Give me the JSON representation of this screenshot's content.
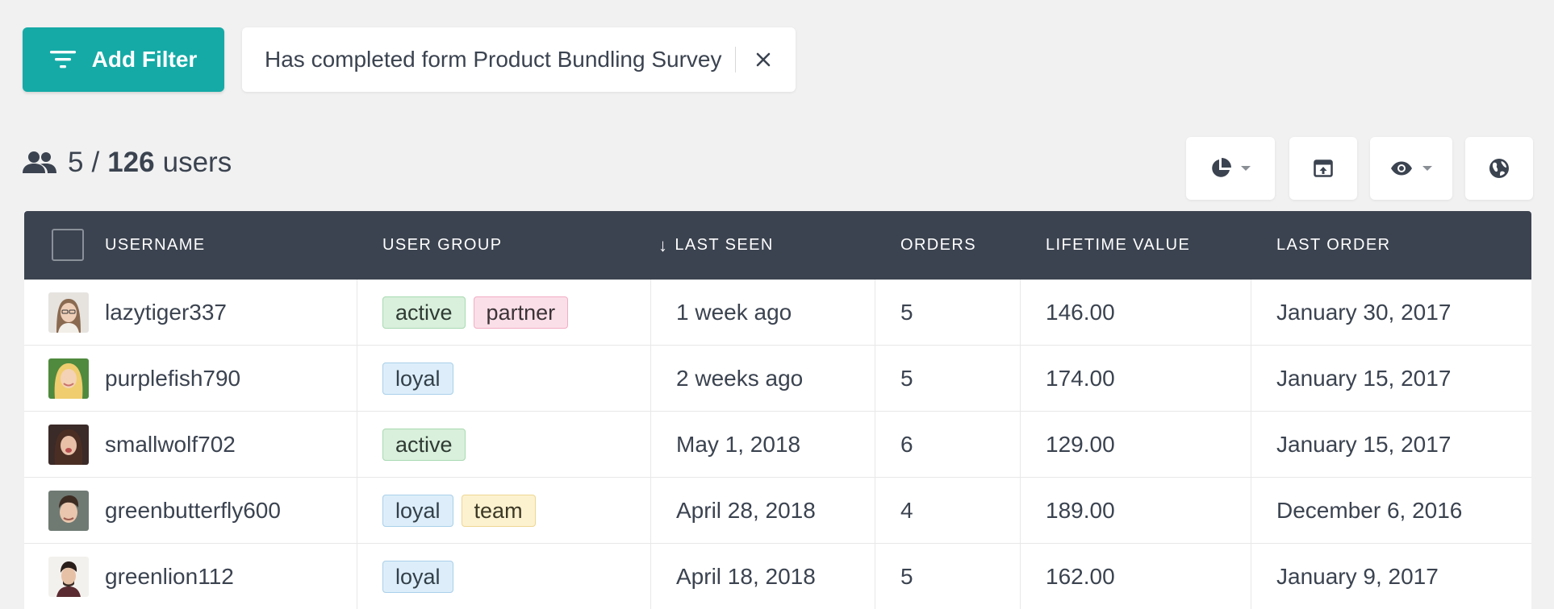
{
  "filter_bar": {
    "add_filter_label": "Add Filter",
    "active_filter": "Has completed form Product Bundling Survey"
  },
  "summary": {
    "shown": "5",
    "separator": "/",
    "total": "126",
    "unit": "users"
  },
  "toolbar": {
    "icons": [
      "pie-chart-icon",
      "export-icon",
      "eye-icon",
      "globe-icon"
    ]
  },
  "table": {
    "columns": {
      "username": "USERNAME",
      "user_group": "USER GROUP",
      "last_seen": "LAST SEEN",
      "orders": "ORDERS",
      "lifetime_value": "LIFETIME VALUE",
      "last_order": "LAST ORDER"
    },
    "sort_indicator": "↓",
    "rows": [
      {
        "username": "lazytiger337",
        "groups": [
          "active",
          "partner"
        ],
        "last_seen": "1 week ago",
        "orders": "5",
        "lifetime_value": "146.00",
        "last_order": "January 30, 2017"
      },
      {
        "username": "purplefish790",
        "groups": [
          "loyal"
        ],
        "last_seen": "2 weeks ago",
        "orders": "5",
        "lifetime_value": "174.00",
        "last_order": "January 15, 2017"
      },
      {
        "username": "smallwolf702",
        "groups": [
          "active"
        ],
        "last_seen": "May 1, 2018",
        "orders": "6",
        "lifetime_value": "129.00",
        "last_order": "January 15, 2017"
      },
      {
        "username": "greenbutterfly600",
        "groups": [
          "loyal",
          "team"
        ],
        "last_seen": "April 28, 2018",
        "orders": "4",
        "lifetime_value": "189.00",
        "last_order": "December 6, 2016"
      },
      {
        "username": "greenlion112",
        "groups": [
          "loyal"
        ],
        "last_seen": "April 18, 2018",
        "orders": "5",
        "lifetime_value": "162.00",
        "last_order": "January 9, 2017"
      }
    ]
  },
  "colors": {
    "accent": "#15aaa6",
    "header_bg": "#3c4350",
    "page_bg": "#f1f1f1"
  }
}
